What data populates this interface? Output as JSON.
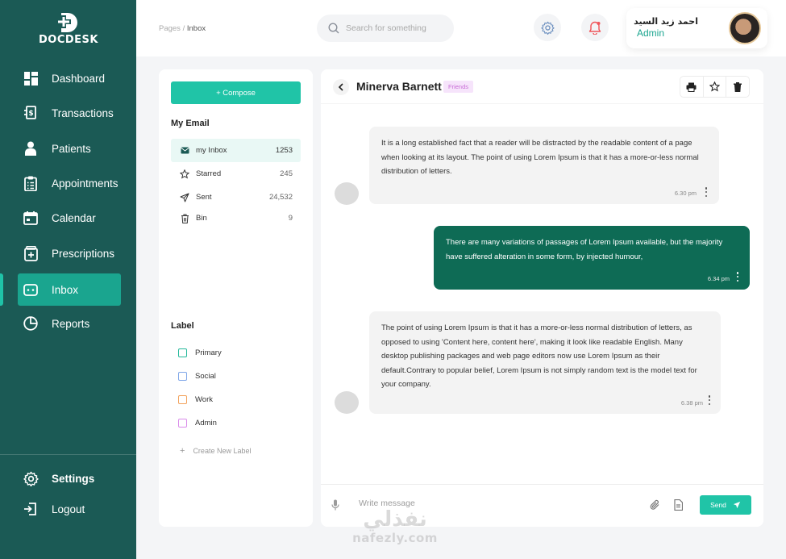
{
  "brand": {
    "name": "DOCDESK"
  },
  "sidebar": {
    "items": [
      {
        "label": "Dashboard",
        "icon": "dashboard-icon"
      },
      {
        "label": "Transactions",
        "icon": "transactions-icon"
      },
      {
        "label": "Patients",
        "icon": "patient-icon"
      },
      {
        "label": "Appointments",
        "icon": "clipboard-icon"
      },
      {
        "label": "Calendar",
        "icon": "calendar-icon"
      },
      {
        "label": "Prescriptions",
        "icon": "prescription-icon"
      },
      {
        "label": "Inbox",
        "icon": "inbox-icon",
        "active": true
      },
      {
        "label": "Reports",
        "icon": "pie-chart-icon"
      }
    ],
    "bottom": [
      {
        "label": "Settings",
        "icon": "gear-icon"
      },
      {
        "label": "Logout",
        "icon": "logout-icon"
      }
    ]
  },
  "header": {
    "breadcrumb": {
      "parent": "Pages",
      "separator": "/",
      "current": "Inbox"
    },
    "search": {
      "placeholder": "Search for something"
    },
    "profile": {
      "name": "احمد زيد السيد",
      "role": "Admin"
    }
  },
  "mail": {
    "compose_label": "+ Compose",
    "my_email_title": "My Email",
    "folders": [
      {
        "name": "my Inbox",
        "count": "1253",
        "icon": "mail-icon",
        "active": true
      },
      {
        "name": "Starred",
        "count": "245",
        "icon": "star-icon"
      },
      {
        "name": "Sent",
        "count": "24,532",
        "icon": "send-icon"
      },
      {
        "name": "Bin",
        "count": "9",
        "icon": "trash-icon"
      }
    ],
    "label_title": "Label",
    "labels": [
      {
        "name": "Primary",
        "color": "#23b89a"
      },
      {
        "name": "Social",
        "color": "#7fa6e8"
      },
      {
        "name": "Work",
        "color": "#f2a25c"
      },
      {
        "name": "Admin",
        "color": "#d98bea"
      }
    ],
    "create_label": "Create New Label"
  },
  "chat": {
    "contact": "Minerva Barnett",
    "tag": "Friends",
    "messages": [
      {
        "direction": "in",
        "text": "It is a long established fact that a reader will be distracted by the readable content of a page when looking at its layout. The point of using Lorem Ipsum is that it has a more-or-less normal distribution of letters.",
        "time": "6.30 pm"
      },
      {
        "direction": "out",
        "text": "There are many variations of passages of Lorem Ipsum available, but the majority have suffered alteration in some form, by injected humour,",
        "time": "6.34 pm"
      },
      {
        "direction": "in",
        "text": "The point of using Lorem Ipsum is that it has a more-or-less normal distribution of letters, as opposed to using 'Content here, content here', making it look like readable English. Many desktop publishing packages and web page editors now use Lorem Ipsum as their default.Contrary to popular belief, Lorem Ipsum is not simply random text is the model text for your company.",
        "time": "6.38 pm"
      }
    ],
    "composer": {
      "placeholder": "Write message",
      "send_label": "Send"
    }
  },
  "colors": {
    "sidebar": "#1b5a55",
    "accent": "#20c4a7",
    "outgoing_bubble": "#0e6b55"
  },
  "watermark": {
    "arabic": "نفذلي",
    "latin": "nafezly.com"
  }
}
